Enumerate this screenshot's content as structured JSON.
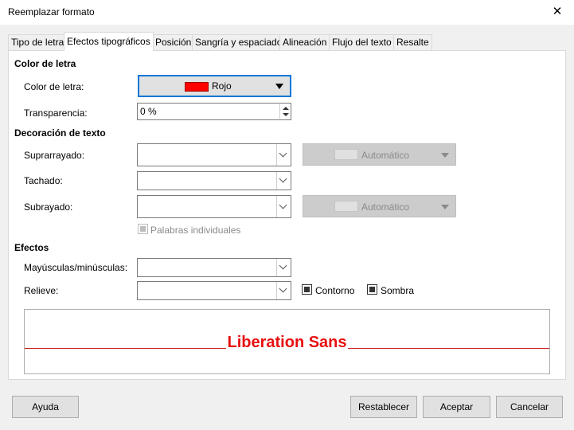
{
  "window": {
    "title": "Reemplazar formato"
  },
  "tabs": [
    {
      "label": "Tipo de letra"
    },
    {
      "label": "Efectos tipográficos"
    },
    {
      "label": "Posición"
    },
    {
      "label": "Sangría y espaciado"
    },
    {
      "label": "Alineación"
    },
    {
      "label": "Flujo del texto"
    },
    {
      "label": "Resalte"
    }
  ],
  "font_color": {
    "heading": "Color de letra",
    "color_label": "Color de letra:",
    "color_value": "Rojo",
    "color_hex": "#ff0000",
    "transparency_label": "Transparencia:",
    "transparency_value": "0 %"
  },
  "decoration": {
    "heading": "Decoración de texto",
    "overline_label": "Suprarrayado:",
    "overline_value": "",
    "overline_color": "Automático",
    "strikethrough_label": "Tachado:",
    "strikethrough_value": "",
    "underline_label": "Subrayado:",
    "underline_value": "",
    "underline_color": "Automático",
    "individual_words": "Palabras individuales"
  },
  "effects": {
    "heading": "Efectos",
    "case_label": "Mayúsculas/minúsculas:",
    "case_value": "",
    "relief_label": "Relieve:",
    "relief_value": "",
    "outline_label": "Contorno",
    "shadow_label": "Sombra"
  },
  "preview": {
    "text": "Liberation Sans",
    "color": "#e81010"
  },
  "buttons": {
    "help": "Ayuda",
    "reset": "Restablecer",
    "ok": "Aceptar",
    "cancel": "Cancelar"
  }
}
